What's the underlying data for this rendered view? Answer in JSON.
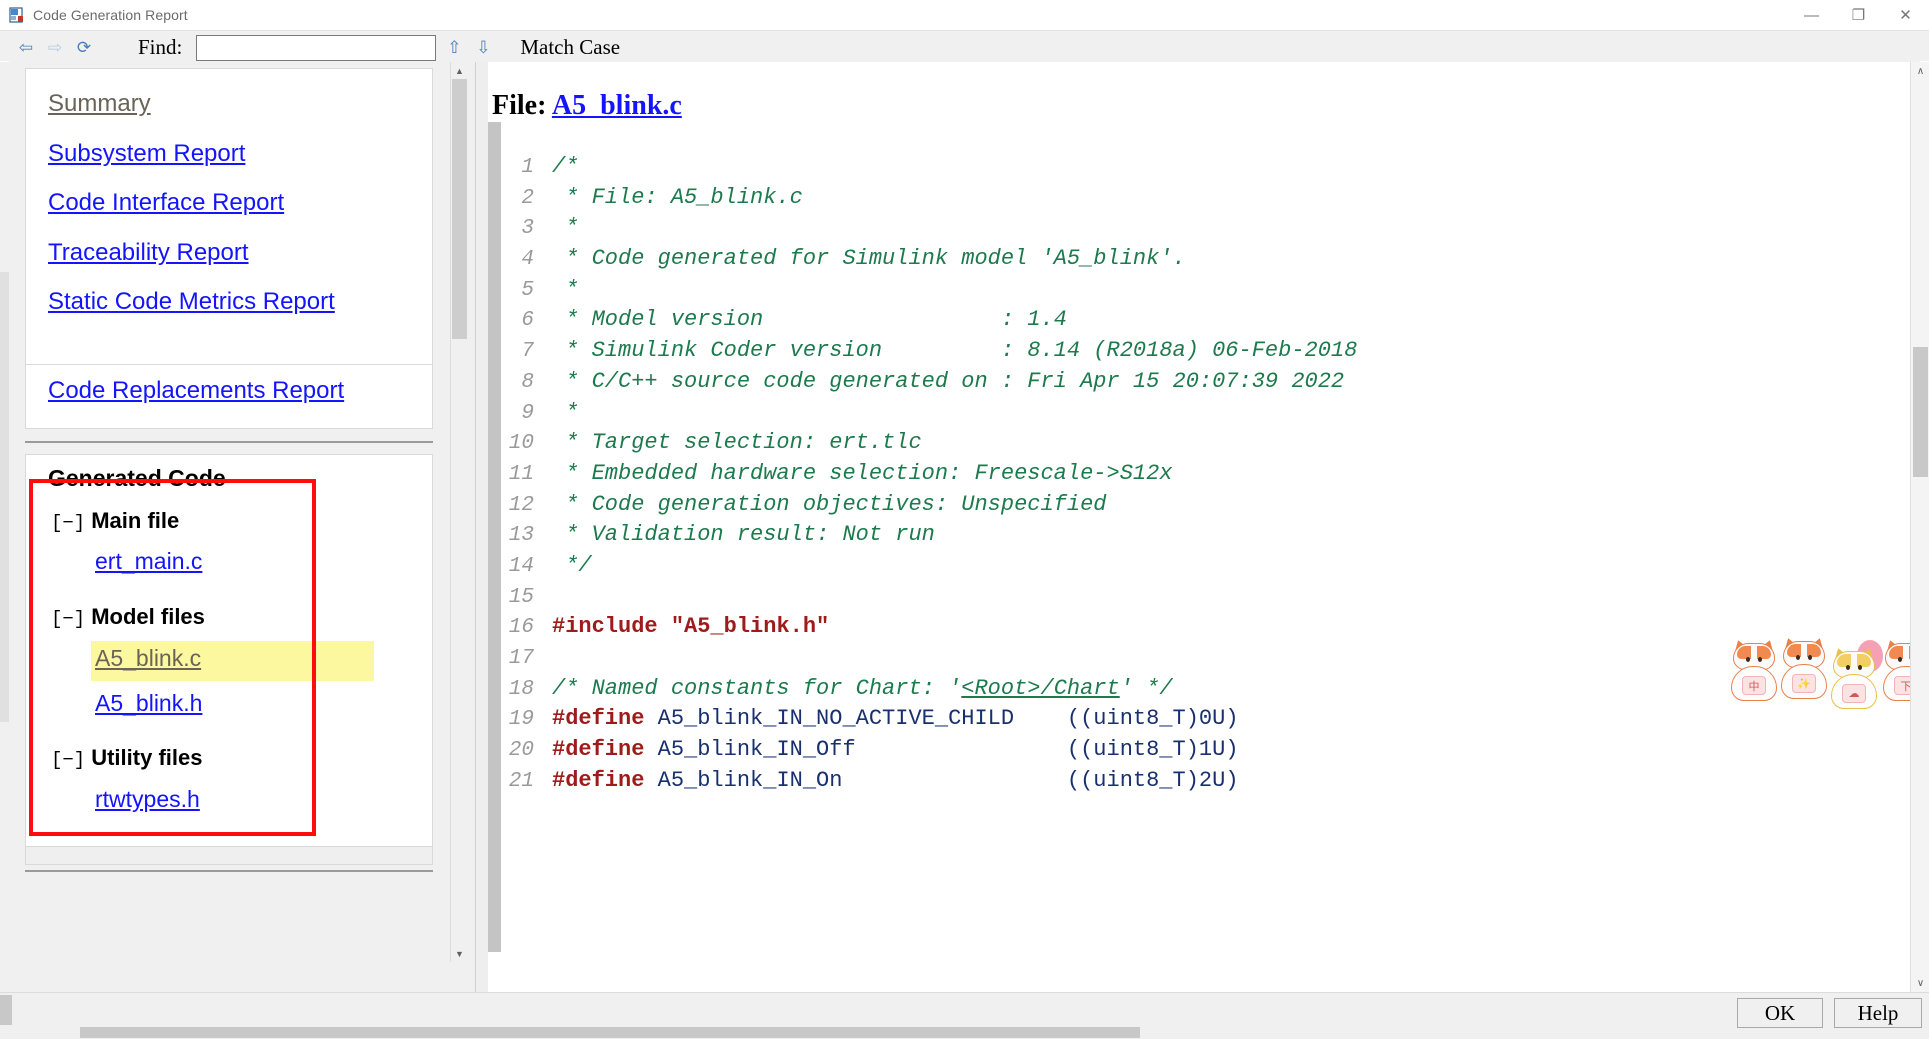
{
  "window": {
    "title": "Code Generation Report",
    "icon": "report-icon",
    "minimize_label": "—",
    "maximize_label": "❐",
    "close_label": "✕"
  },
  "toolbar": {
    "back_label": "⇦",
    "forward_label": "⇨",
    "refresh_label": "⟳",
    "find_label": "Find:",
    "find_value": "",
    "find_placeholder": "",
    "find_prev_label": "⇧",
    "find_next_label": "⇩",
    "match_case_label": "Match Case"
  },
  "sidebar": {
    "reports": [
      {
        "label": "Summary",
        "state": "visited"
      },
      {
        "label": "Subsystem Report",
        "state": "link"
      },
      {
        "label": "Code Interface Report",
        "state": "link"
      },
      {
        "label": "Traceability Report",
        "state": "link"
      },
      {
        "label": "Static Code Metrics Report",
        "state": "link"
      },
      {
        "label": "Code Replacements Report",
        "state": "link"
      }
    ],
    "generated_code_title": "Generated Code",
    "groups": [
      {
        "toggle": "[−]",
        "label": "Main file",
        "files": [
          {
            "name": "ert_main.c",
            "state": "link"
          }
        ]
      },
      {
        "toggle": "[−]",
        "label": "Model files",
        "files": [
          {
            "name": "A5_blink.c",
            "state": "visited-selected"
          },
          {
            "name": "A5_blink.h",
            "state": "link"
          }
        ]
      },
      {
        "toggle": "[−]",
        "label": "Utility files",
        "files": [
          {
            "name": "rtwtypes.h",
            "state": "link"
          }
        ]
      }
    ],
    "scrollbar": {
      "up": "▲",
      "down": "▼"
    }
  },
  "content": {
    "file_heading_label": "File:",
    "file_heading_name": "A5_blink.c",
    "scrollbar": {
      "up": "∧",
      "down": "∨"
    },
    "lines": [
      {
        "n": "1",
        "segments": [
          {
            "t": "/*",
            "c": "cmt"
          }
        ]
      },
      {
        "n": "2",
        "segments": [
          {
            "t": " * File: A5_blink.c",
            "c": "cmt"
          }
        ]
      },
      {
        "n": "3",
        "segments": [
          {
            "t": " *",
            "c": "cmt"
          }
        ]
      },
      {
        "n": "4",
        "segments": [
          {
            "t": " * Code generated for Simulink model 'A5_blink'.",
            "c": "cmt"
          }
        ]
      },
      {
        "n": "5",
        "segments": [
          {
            "t": " *",
            "c": "cmt"
          }
        ]
      },
      {
        "n": "6",
        "segments": [
          {
            "t": " * Model version                  : 1.4",
            "c": "cmt"
          }
        ]
      },
      {
        "n": "7",
        "segments": [
          {
            "t": " * Simulink Coder version         : 8.14 (R2018a) 06-Feb-2018",
            "c": "cmt"
          }
        ]
      },
      {
        "n": "8",
        "segments": [
          {
            "t": " * C/C++ source code generated on : Fri Apr 15 20:07:39 2022",
            "c": "cmt"
          }
        ]
      },
      {
        "n": "9",
        "segments": [
          {
            "t": " *",
            "c": "cmt"
          }
        ]
      },
      {
        "n": "10",
        "segments": [
          {
            "t": " * Target selection: ert.tlc",
            "c": "cmt"
          }
        ]
      },
      {
        "n": "11",
        "segments": [
          {
            "t": " * Embedded hardware selection: Freescale->S12x",
            "c": "cmt"
          }
        ]
      },
      {
        "n": "12",
        "segments": [
          {
            "t": " * Code generation objectives: Unspecified",
            "c": "cmt"
          }
        ]
      },
      {
        "n": "13",
        "segments": [
          {
            "t": " * Validation result: Not run",
            "c": "cmt"
          }
        ]
      },
      {
        "n": "14",
        "segments": [
          {
            "t": " */",
            "c": "cmt"
          }
        ]
      },
      {
        "n": "15",
        "segments": [
          {
            "t": "",
            "c": "cmt"
          }
        ]
      },
      {
        "n": "16",
        "segments": [
          {
            "t": "#include",
            "c": "pp"
          },
          {
            "t": " ",
            "c": "idn"
          },
          {
            "t": "\"A5_blink.h\"",
            "c": "str"
          }
        ]
      },
      {
        "n": "17",
        "segments": [
          {
            "t": "",
            "c": "cmt"
          }
        ]
      },
      {
        "n": "18",
        "segments": [
          {
            "t": "/* Named constants for Chart: '",
            "c": "cmt"
          },
          {
            "t": "<Root>/Chart",
            "c": "cmt-a"
          },
          {
            "t": "' */",
            "c": "cmt"
          }
        ]
      },
      {
        "n": "19",
        "segments": [
          {
            "t": "#define",
            "c": "pp"
          },
          {
            "t": " A5_blink_IN_NO_ACTIVE_CHILD    ((uint8_T)0U)",
            "c": "idn"
          }
        ]
      },
      {
        "n": "20",
        "segments": [
          {
            "t": "#define",
            "c": "pp"
          },
          {
            "t": " A5_blink_IN_Off                ((uint8_T)1U)",
            "c": "idn"
          }
        ]
      },
      {
        "n": "21",
        "segments": [
          {
            "t": "#define",
            "c": "pp"
          },
          {
            "t": " A5_blink_IN_On                 ((uint8_T)2U)",
            "c": "idn"
          }
        ]
      }
    ]
  },
  "stickers": {
    "cats": [
      {
        "name": "cat-sticker-1",
        "tag": "中"
      },
      {
        "name": "cat-sticker-2",
        "tag": "✨"
      },
      {
        "name": "cat-sticker-balloon",
        "tag": "☁"
      },
      {
        "name": "cat-sticker-4",
        "tag": "下"
      }
    ]
  },
  "bottom": {
    "ok_label": "OK",
    "help_label": "Help"
  }
}
